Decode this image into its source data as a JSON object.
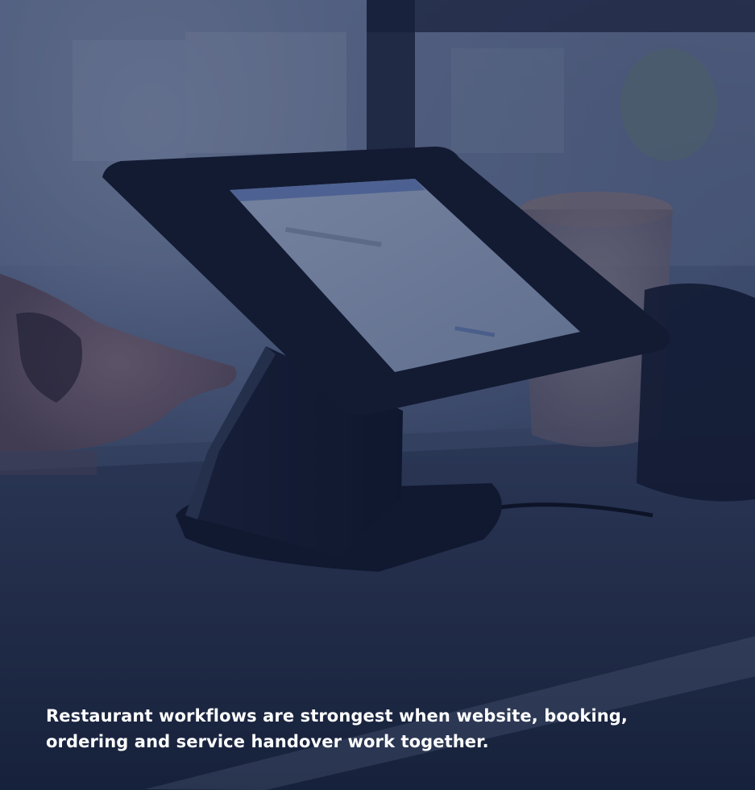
{
  "hero": {
    "caption": "Restaurant workflows are strongest when website, booking, ordering and service handover work together."
  },
  "palette": {
    "overlay": "#122046",
    "text": "#ffffff"
  }
}
